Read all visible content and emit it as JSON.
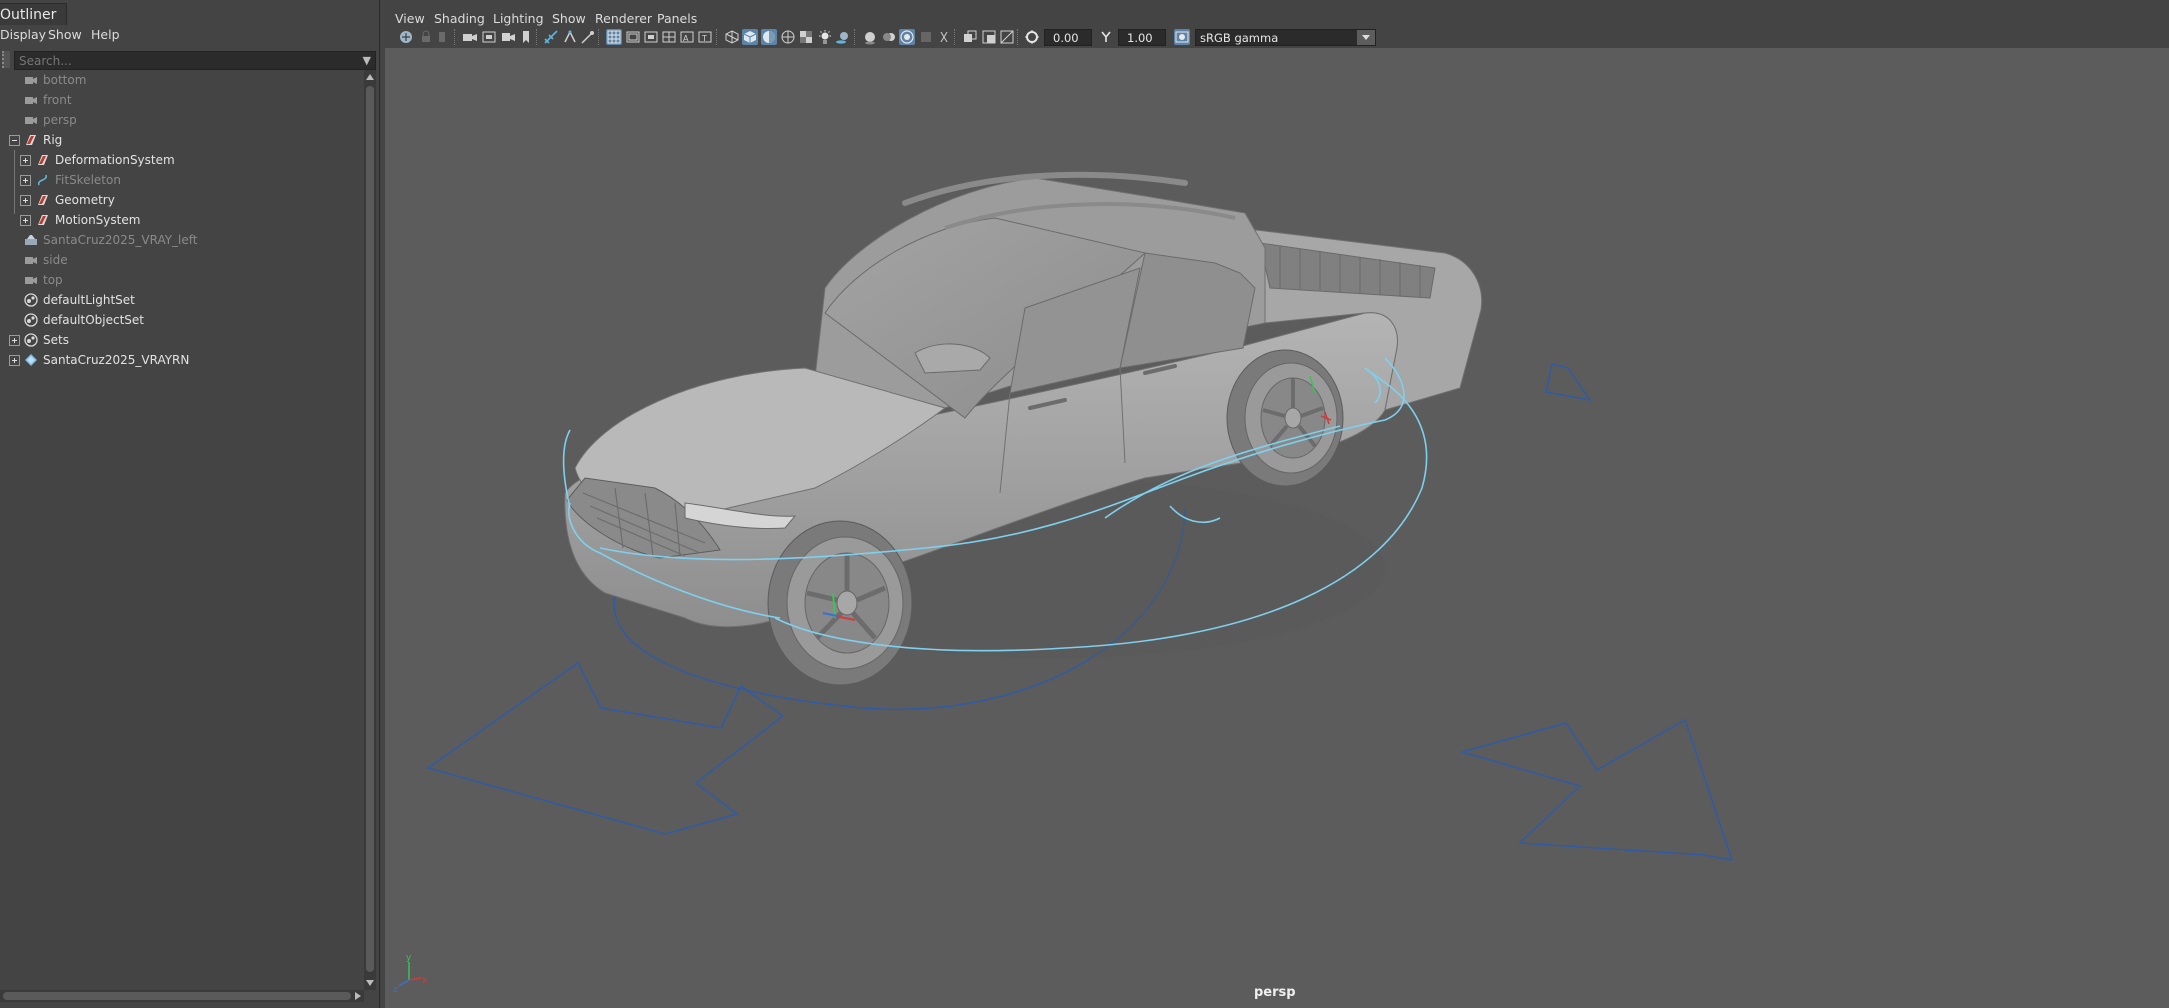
{
  "outliner": {
    "title": "Outliner",
    "menu": [
      "Display",
      "Show",
      "Help"
    ],
    "search_placeholder": "Search...",
    "items": [
      {
        "label": "bottom",
        "type": "camera",
        "state": "hidden"
      },
      {
        "label": "front",
        "type": "camera",
        "state": "hidden"
      },
      {
        "label": "persp",
        "type": "camera",
        "state": "hidden"
      },
      {
        "label": "Rig",
        "type": "group",
        "expanded": true
      },
      {
        "label": "DeformationSystem",
        "type": "group",
        "expanded": false
      },
      {
        "label": "FitSkeleton",
        "type": "curve",
        "state": "hidden",
        "expanded": false
      },
      {
        "label": "Geometry",
        "type": "group",
        "expanded": false
      },
      {
        "label": "MotionSystem",
        "type": "group",
        "expanded": false
      },
      {
        "label": "SantaCruz2025_VRAY_left",
        "type": "light",
        "state": "hidden"
      },
      {
        "label": "side",
        "type": "camera",
        "state": "hidden"
      },
      {
        "label": "top",
        "type": "camera",
        "state": "hidden"
      },
      {
        "label": "defaultLightSet",
        "type": "set"
      },
      {
        "label": "defaultObjectSet",
        "type": "set"
      },
      {
        "label": "Sets",
        "type": "set",
        "expanded": false
      },
      {
        "label": "SantaCruz2025_VRAYRN",
        "type": "reference",
        "expanded": false
      }
    ]
  },
  "panel": {
    "menu": [
      "View",
      "Shading",
      "Lighting",
      "Show",
      "Renderer",
      "Panels"
    ],
    "exposure": "0.00",
    "gamma": "1.00",
    "color_space": "sRGB gamma",
    "camera": "persp"
  },
  "colors": {
    "viewport_bg": "#5c5c5c",
    "panel_bg": "#444444",
    "rig_curve_light": "#7fd0ee",
    "rig_curve_dark": "#2f5ba6",
    "highlight": "#5b84a8"
  }
}
